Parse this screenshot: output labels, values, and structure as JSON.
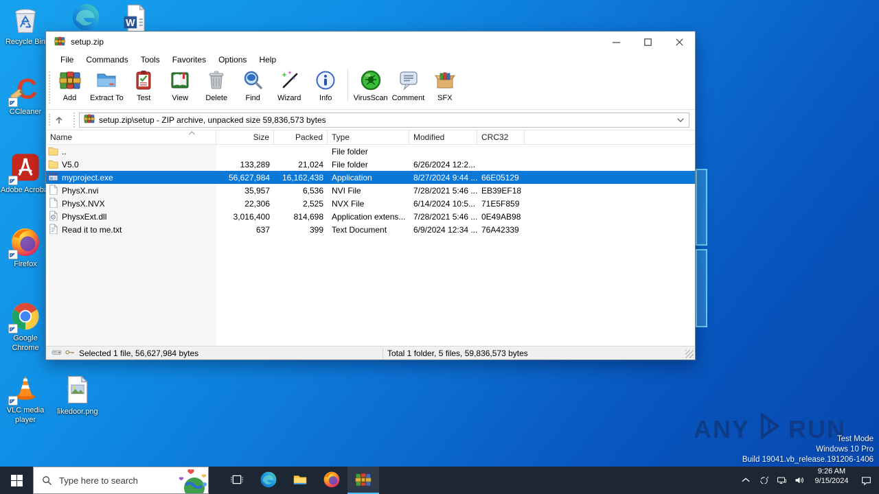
{
  "desktop": {
    "icons": [
      {
        "id": "recycle-bin",
        "label": "Recycle Bin",
        "shortcut": false
      },
      {
        "id": "edge",
        "label": "",
        "shortcut": false
      },
      {
        "id": "word-doc",
        "label": "",
        "shortcut": false
      },
      {
        "id": "ccleaner",
        "label": "CCleaner",
        "shortcut": true
      },
      {
        "id": "adobe-acrobat",
        "label": "Adobe Acrobat",
        "shortcut": true
      },
      {
        "id": "firefox",
        "label": "Firefox",
        "shortcut": true
      },
      {
        "id": "google-chrome",
        "label": "Google Chrome",
        "shortcut": true
      },
      {
        "id": "vlc",
        "label": "VLC media player",
        "shortcut": true
      },
      {
        "id": "likedoor",
        "label": "likedoor.png",
        "shortcut": false
      }
    ],
    "watermark": {
      "brand_left": "ANY",
      "brand_right": "RUN",
      "line1": "Test Mode",
      "line2": "Windows 10 Pro",
      "line3": "Build 19041.vb_release.191206-1406"
    }
  },
  "window": {
    "title": "setup.zip",
    "menus": [
      "File",
      "Commands",
      "Tools",
      "Favorites",
      "Options",
      "Help"
    ],
    "toolbar": [
      {
        "icon": "add",
        "label": "Add"
      },
      {
        "icon": "extract",
        "label": "Extract To"
      },
      {
        "icon": "test",
        "label": "Test"
      },
      {
        "icon": "view",
        "label": "View"
      },
      {
        "icon": "delete",
        "label": "Delete"
      },
      {
        "icon": "find",
        "label": "Find"
      },
      {
        "icon": "wizard",
        "label": "Wizard"
      },
      {
        "icon": "info",
        "label": "Info"
      },
      {
        "icon": "virusscan",
        "label": "VirusScan",
        "sep": true
      },
      {
        "icon": "comment",
        "label": "Comment"
      },
      {
        "icon": "sfx",
        "label": "SFX"
      }
    ],
    "address": "setup.zip\\setup - ZIP archive, unpacked size 59,836,573 bytes",
    "columns": [
      {
        "label": "Name",
        "align": "left"
      },
      {
        "label": "Size",
        "align": "right"
      },
      {
        "label": "Packed",
        "align": "right"
      },
      {
        "label": "Type",
        "align": "left"
      },
      {
        "label": "Modified",
        "align": "left"
      },
      {
        "label": "CRC32",
        "align": "left"
      }
    ],
    "rows": [
      {
        "icon": "folder-sm",
        "name": "..",
        "size": "",
        "packed": "",
        "type": "File folder",
        "modified": "",
        "crc32": "",
        "selected": false
      },
      {
        "icon": "folder-sm",
        "name": "V5.0",
        "size": "133,289",
        "packed": "21,024",
        "type": "File folder",
        "modified": "6/26/2024 12:2...",
        "crc32": "",
        "selected": false
      },
      {
        "icon": "app-sm",
        "name": "myproject.exe",
        "size": "56,627,984",
        "packed": "16,162,438",
        "type": "Application",
        "modified": "8/27/2024 9:44 ...",
        "crc32": "66E05129",
        "selected": true
      },
      {
        "icon": "file-sm",
        "name": "PhysX.nvi",
        "size": "35,957",
        "packed": "6,536",
        "type": "NVI File",
        "modified": "7/28/2021 5:46 ...",
        "crc32": "EB39EF18",
        "selected": false
      },
      {
        "icon": "file-sm",
        "name": "PhysX.NVX",
        "size": "22,306",
        "packed": "2,525",
        "type": "NVX File",
        "modified": "6/14/2024 10:5...",
        "crc32": "71E5F859",
        "selected": false
      },
      {
        "icon": "dll-sm",
        "name": "PhysxExt.dll",
        "size": "3,016,400",
        "packed": "814,698",
        "type": "Application extens...",
        "modified": "7/28/2021 5:46 ...",
        "crc32": "0E49AB98",
        "selected": false
      },
      {
        "icon": "txt-sm",
        "name": "Read it to me.txt",
        "size": "637",
        "packed": "399",
        "type": "Text Document",
        "modified": "6/9/2024 12:34 ...",
        "crc32": "76A42339",
        "selected": false
      }
    ],
    "status_left": "Selected 1 file, 56,627,984 bytes",
    "status_right": "Total 1 folder, 5 files, 59,836,573 bytes"
  },
  "taskbar": {
    "search_placeholder": "Type here to search",
    "buttons": [
      {
        "id": "task-view",
        "active": false
      },
      {
        "id": "edge",
        "active": false
      },
      {
        "id": "file-explorer",
        "active": false
      },
      {
        "id": "firefox",
        "active": false
      },
      {
        "id": "winrar",
        "active": true
      }
    ],
    "clock_time": "9:26 AM",
    "clock_date": "9/15/2024"
  },
  "colors": {
    "selection": "#0a78d7",
    "taskbar": "#1d2633",
    "accent_underline": "#4cc2ff",
    "desktop_top": "#17a2ef",
    "desktop_bottom": "#0746ad"
  }
}
